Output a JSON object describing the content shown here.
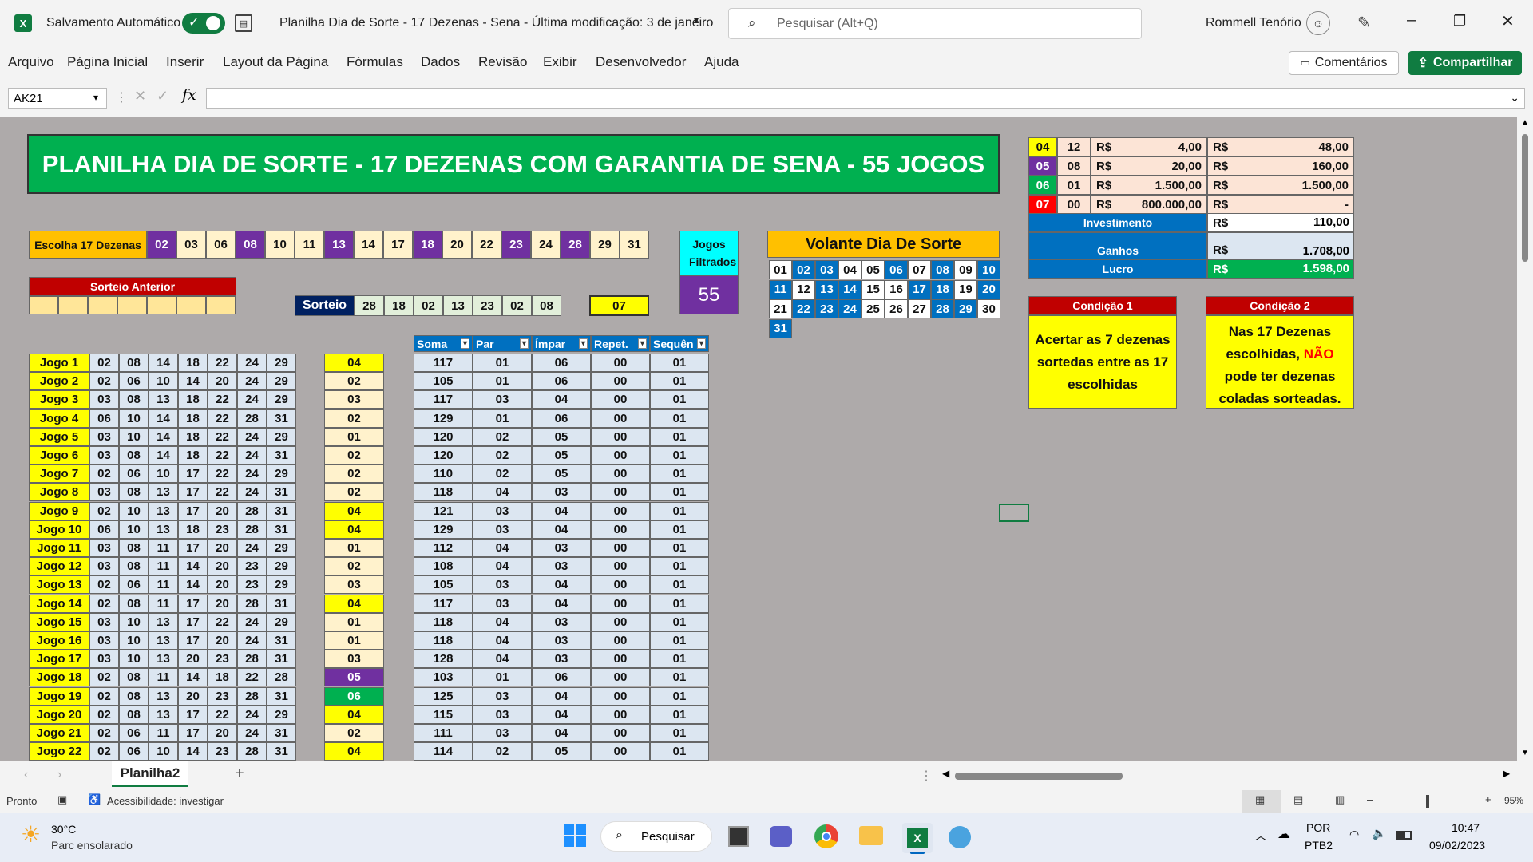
{
  "titlebar": {
    "autosave": "Salvamento Automático",
    "doc_title": "Planilha Dia de Sorte - 17 Dezenas - Sena  - Última modificação: 3 de janeiro",
    "search_placeholder": "Pesquisar (Alt+Q)",
    "user": "Rommell Tenório"
  },
  "menu": {
    "items": [
      "Arquivo",
      "Página Inicial",
      "Inserir",
      "Layout da Página",
      "Fórmulas",
      "Dados",
      "Revisão",
      "Exibir",
      "Desenvolvedor",
      "Ajuda"
    ],
    "comments": "Comentários",
    "share": "Compartilhar"
  },
  "formula": {
    "namebox": "AK21",
    "fx": "fx",
    "value": ""
  },
  "sheet": {
    "title": "PLANILHA DIA DE SORTE - 17 DEZENAS COM GARANTIA DE SENA - 55 JOGOS",
    "choose_label": "Escolha 17 Dezenas",
    "chosen": [
      "02",
      "03",
      "06",
      "08",
      "10",
      "11",
      "13",
      "14",
      "17",
      "18",
      "20",
      "22",
      "23",
      "24",
      "28",
      "29",
      "31"
    ],
    "chosen_purple": [
      0,
      3,
      6,
      9,
      12,
      14
    ],
    "jogos_filtrados_label": "Jogos Filtrados",
    "jogos_filtrados_value": "55",
    "sorteio_anterior": "Sorteio Anterior",
    "sorteio_label": "Sorteio",
    "sorteio": [
      "28",
      "18",
      "02",
      "13",
      "23",
      "02",
      "08"
    ],
    "mes_sorte": "07",
    "volante_title": "Volante Dia De Sorte",
    "volante": [
      "01",
      "02",
      "03",
      "04",
      "05",
      "06",
      "07",
      "08",
      "09",
      "10",
      "11",
      "12",
      "13",
      "14",
      "15",
      "16",
      "17",
      "18",
      "19",
      "20",
      "21",
      "22",
      "23",
      "24",
      "25",
      "26",
      "27",
      "28",
      "29",
      "30",
      "31"
    ],
    "volante_blue": [
      "02",
      "03",
      "06",
      "08",
      "10",
      "11",
      "13",
      "14",
      "17",
      "18",
      "20",
      "22",
      "23",
      "24",
      "28",
      "29",
      "31"
    ],
    "prize_rows": [
      {
        "hits": "04",
        "count": "12",
        "cur1": "R$",
        "unit": "4,00",
        "cur2": "R$",
        "total": "48,00",
        "color": "#ffff00"
      },
      {
        "hits": "05",
        "count": "08",
        "cur1": "R$",
        "unit": "20,00",
        "cur2": "R$",
        "total": "160,00",
        "color": "#7030a0"
      },
      {
        "hits": "06",
        "count": "01",
        "cur1": "R$",
        "unit": "1.500,00",
        "cur2": "R$",
        "total": "1.500,00",
        "color": "#00b050"
      },
      {
        "hits": "07",
        "count": "00",
        "cur1": "R$",
        "unit": "800.000,00",
        "cur2": "R$",
        "total": "-",
        "color": "#ff0000"
      }
    ],
    "investimento_label": "Investimento",
    "investimento_cur": "R$",
    "investimento": "110,00",
    "ganhos_label": "Ganhos",
    "ganhos_cur": "R$",
    "ganhos": "1.708,00",
    "lucro_label": "Lucro",
    "lucro_cur": "R$",
    "lucro": "1.598,00",
    "cond1_title": "Condição 1",
    "cond1_text": "Acertar as 7 dezenas sortedas entre as 17 escolhidas",
    "cond2_title": "Condição 2",
    "cond2_text_a": "Nas 17 Dezenas escolhidas,",
    "cond2_text_red": "NÃO",
    "cond2_text_b": "pode ter dezenas coladas sorteadas.",
    "stats_headers": [
      "Soma",
      "Par",
      "Ímpar",
      "Repet.",
      "Sequên"
    ],
    "games": [
      {
        "name": "Jogo 1",
        "nums": [
          "02",
          "08",
          "14",
          "18",
          "22",
          "24",
          "29"
        ],
        "hits": "04",
        "hc": "y",
        "stats": [
          "117",
          "01",
          "06",
          "00",
          "01"
        ]
      },
      {
        "name": "Jogo 2",
        "nums": [
          "02",
          "06",
          "10",
          "14",
          "20",
          "24",
          "29"
        ],
        "hits": "02",
        "hc": "w",
        "stats": [
          "105",
          "01",
          "06",
          "00",
          "01"
        ]
      },
      {
        "name": "Jogo 3",
        "nums": [
          "03",
          "08",
          "13",
          "18",
          "22",
          "24",
          "29"
        ],
        "hits": "03",
        "hc": "w",
        "stats": [
          "117",
          "03",
          "04",
          "00",
          "01"
        ]
      },
      {
        "name": "Jogo 4",
        "nums": [
          "06",
          "10",
          "14",
          "18",
          "22",
          "28",
          "31"
        ],
        "hits": "02",
        "hc": "w",
        "stats": [
          "129",
          "01",
          "06",
          "00",
          "01"
        ]
      },
      {
        "name": "Jogo 5",
        "nums": [
          "03",
          "10",
          "14",
          "18",
          "22",
          "24",
          "29"
        ],
        "hits": "01",
        "hc": "w",
        "stats": [
          "120",
          "02",
          "05",
          "00",
          "01"
        ]
      },
      {
        "name": "Jogo 6",
        "nums": [
          "03",
          "08",
          "14",
          "18",
          "22",
          "24",
          "31"
        ],
        "hits": "02",
        "hc": "w",
        "stats": [
          "120",
          "02",
          "05",
          "00",
          "01"
        ]
      },
      {
        "name": "Jogo 7",
        "nums": [
          "02",
          "06",
          "10",
          "17",
          "22",
          "24",
          "29"
        ],
        "hits": "02",
        "hc": "w",
        "stats": [
          "110",
          "02",
          "05",
          "00",
          "01"
        ]
      },
      {
        "name": "Jogo 8",
        "nums": [
          "03",
          "08",
          "13",
          "17",
          "22",
          "24",
          "31"
        ],
        "hits": "02",
        "hc": "w",
        "stats": [
          "118",
          "04",
          "03",
          "00",
          "01"
        ]
      },
      {
        "name": "Jogo 9",
        "nums": [
          "02",
          "10",
          "13",
          "17",
          "20",
          "28",
          "31"
        ],
        "hits": "04",
        "hc": "y",
        "stats": [
          "121",
          "03",
          "04",
          "00",
          "01"
        ]
      },
      {
        "name": "Jogo 10",
        "nums": [
          "06",
          "10",
          "13",
          "18",
          "23",
          "28",
          "31"
        ],
        "hits": "04",
        "hc": "y",
        "stats": [
          "129",
          "03",
          "04",
          "00",
          "01"
        ]
      },
      {
        "name": "Jogo 11",
        "nums": [
          "03",
          "08",
          "11",
          "17",
          "20",
          "24",
          "29"
        ],
        "hits": "01",
        "hc": "w",
        "stats": [
          "112",
          "04",
          "03",
          "00",
          "01"
        ]
      },
      {
        "name": "Jogo 12",
        "nums": [
          "03",
          "08",
          "11",
          "14",
          "20",
          "23",
          "29"
        ],
        "hits": "02",
        "hc": "w",
        "stats": [
          "108",
          "04",
          "03",
          "00",
          "01"
        ]
      },
      {
        "name": "Jogo 13",
        "nums": [
          "02",
          "06",
          "11",
          "14",
          "20",
          "23",
          "29"
        ],
        "hits": "03",
        "hc": "w",
        "stats": [
          "105",
          "03",
          "04",
          "00",
          "01"
        ]
      },
      {
        "name": "Jogo 14",
        "nums": [
          "02",
          "08",
          "11",
          "17",
          "20",
          "28",
          "31"
        ],
        "hits": "04",
        "hc": "y",
        "stats": [
          "117",
          "03",
          "04",
          "00",
          "01"
        ]
      },
      {
        "name": "Jogo 15",
        "nums": [
          "03",
          "10",
          "13",
          "17",
          "22",
          "24",
          "29"
        ],
        "hits": "01",
        "hc": "w",
        "stats": [
          "118",
          "04",
          "03",
          "00",
          "01"
        ]
      },
      {
        "name": "Jogo 16",
        "nums": [
          "03",
          "10",
          "13",
          "17",
          "20",
          "24",
          "31"
        ],
        "hits": "01",
        "hc": "w",
        "stats": [
          "118",
          "04",
          "03",
          "00",
          "01"
        ]
      },
      {
        "name": "Jogo 17",
        "nums": [
          "03",
          "10",
          "13",
          "20",
          "23",
          "28",
          "31"
        ],
        "hits": "03",
        "hc": "w",
        "stats": [
          "128",
          "04",
          "03",
          "00",
          "01"
        ]
      },
      {
        "name": "Jogo 18",
        "nums": [
          "02",
          "08",
          "11",
          "14",
          "18",
          "22",
          "28"
        ],
        "hits": "05",
        "hc": "p",
        "stats": [
          "103",
          "01",
          "06",
          "00",
          "01"
        ]
      },
      {
        "name": "Jogo 19",
        "nums": [
          "02",
          "08",
          "13",
          "20",
          "23",
          "28",
          "31"
        ],
        "hits": "06",
        "hc": "g",
        "stats": [
          "125",
          "03",
          "04",
          "00",
          "01"
        ]
      },
      {
        "name": "Jogo 20",
        "nums": [
          "02",
          "08",
          "13",
          "17",
          "22",
          "24",
          "29"
        ],
        "hits": "04",
        "hc": "y",
        "stats": [
          "115",
          "03",
          "04",
          "00",
          "01"
        ]
      },
      {
        "name": "Jogo 21",
        "nums": [
          "02",
          "06",
          "11",
          "17",
          "20",
          "24",
          "31"
        ],
        "hits": "02",
        "hc": "w",
        "stats": [
          "111",
          "03",
          "04",
          "00",
          "01"
        ]
      },
      {
        "name": "Jogo 22",
        "nums": [
          "02",
          "06",
          "10",
          "14",
          "23",
          "28",
          "31"
        ],
        "hits": "04",
        "hc": "y",
        "stats": [
          "114",
          "02",
          "05",
          "00",
          "01"
        ]
      }
    ]
  },
  "tabs": {
    "sheet": "Planilha2",
    "add": "+"
  },
  "status": {
    "ready": "Pronto",
    "accessibility": "Acessibilidade: investigar",
    "zoom": "95%"
  },
  "taskbar": {
    "temp": "30°C",
    "weather": "Parc ensolarado",
    "search": "Pesquisar",
    "lang1": "POR",
    "lang2": "PTB2",
    "time": "10:47",
    "date": "09/02/2023"
  },
  "colors": {
    "excel_green": "#107c41",
    "sheet_bg": "#aeaaaa",
    "title_green": "#00b050",
    "purple": "#7030a0",
    "blue": "#0070c0"
  }
}
